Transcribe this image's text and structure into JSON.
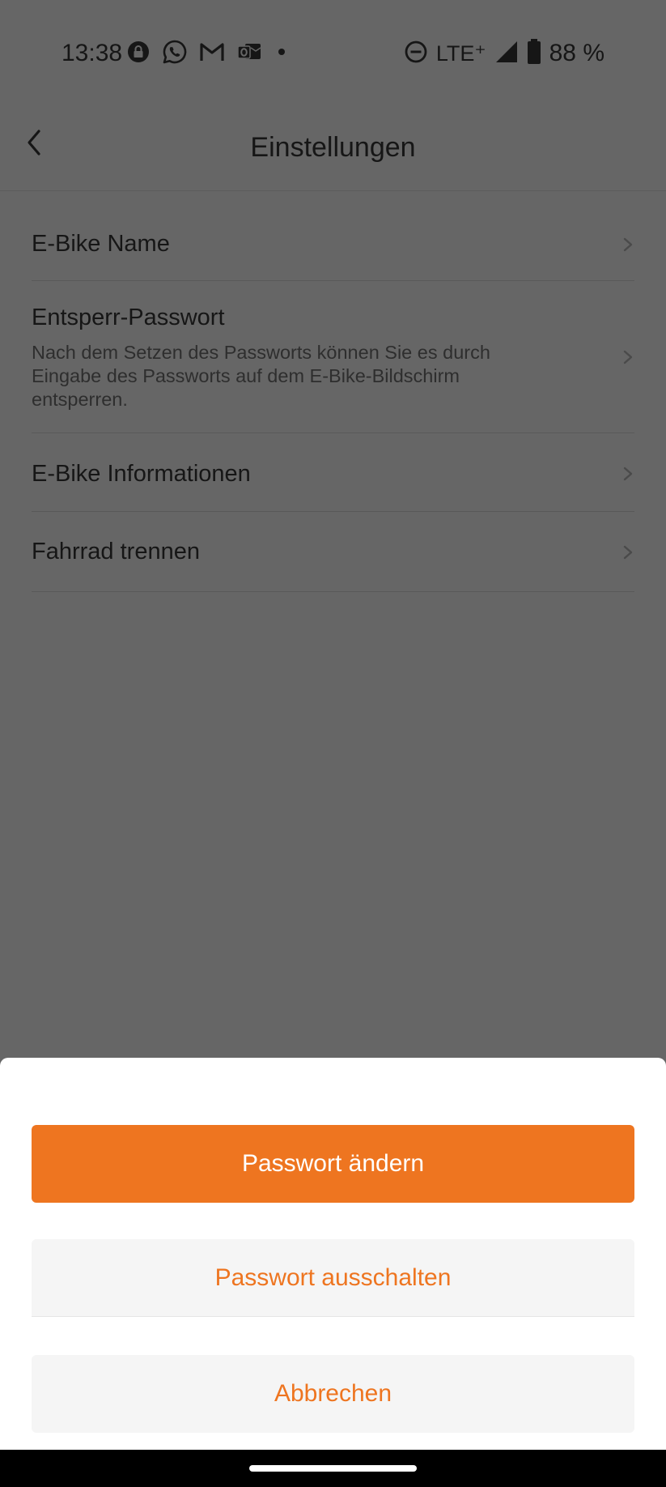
{
  "status_bar": {
    "time": "13:38",
    "network": "LTE⁺",
    "battery": "88 %",
    "icons_left": [
      "lock-notification-icon",
      "whatsapp-icon",
      "gmail-icon",
      "outlook-icon",
      "more-dot-icon"
    ],
    "icons_right": [
      "do-not-disturb-icon",
      "signal-icon",
      "battery-icon"
    ]
  },
  "header": {
    "title": "Einstellungen",
    "back_icon": "chevron-left-icon"
  },
  "settings": {
    "items": [
      {
        "title": "E-Bike Name"
      },
      {
        "title": "Entsperr-Passwort",
        "description": "Nach dem Setzen des Passworts können Sie es durch Eingabe des Passworts auf dem E-Bike-Bildschirm entsperren."
      },
      {
        "title": "E-Bike Informationen"
      },
      {
        "title": "Fahrrad trennen"
      }
    ]
  },
  "sheet": {
    "change_password": "Passwort ändern",
    "disable_password": "Passwort ausschalten",
    "cancel": "Abbrechen"
  },
  "colors": {
    "accent": "#ee7520",
    "dim_background": "#666666",
    "sheet_background": "#ffffff",
    "secondary_button": "#f5f5f5"
  }
}
